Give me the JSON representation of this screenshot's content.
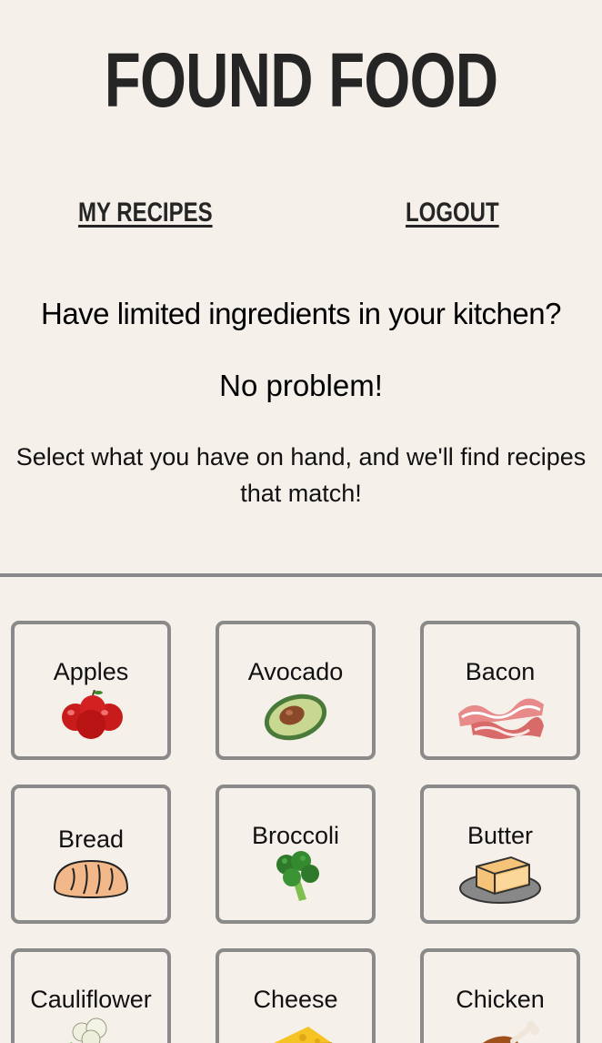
{
  "header": {
    "brand": "FOUND FOOD"
  },
  "nav": {
    "my_recipes": "MY RECIPES",
    "logout": "LOGOUT"
  },
  "intro": {
    "headline": "Have limited ingredients in your kitchen?",
    "subheadline": "No problem!",
    "description": "Select what you have on hand, and we'll find recipes that match!"
  },
  "ingredients": [
    {
      "label": "Apples",
      "icon": "apples-icon"
    },
    {
      "label": "Avocado",
      "icon": "avocado-icon"
    },
    {
      "label": "Bacon",
      "icon": "bacon-icon"
    },
    {
      "label": "Bread",
      "icon": "bread-icon"
    },
    {
      "label": "Broccoli",
      "icon": "broccoli-icon"
    },
    {
      "label": "Butter",
      "icon": "butter-icon"
    },
    {
      "label": "Cauliflower",
      "icon": "cauliflower-icon"
    },
    {
      "label": "Cheese",
      "icon": "cheese-icon"
    },
    {
      "label": "Chicken",
      "icon": "chicken-icon"
    }
  ],
  "colors": {
    "background": "#f5f0ea",
    "text": "#252525",
    "tile_border": "#8a8a8a",
    "divider": "#888888"
  }
}
